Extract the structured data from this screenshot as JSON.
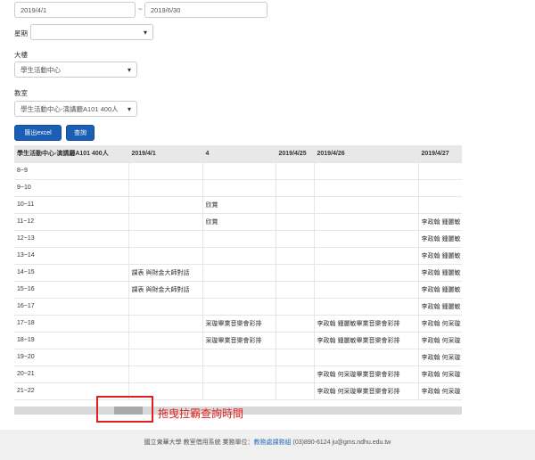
{
  "filters": {
    "date_start": "2019/4/1",
    "date_sep": "~",
    "date_end": "2019/6/30",
    "weekday_label": "星期",
    "weekday_value": "",
    "building_label": "大樓",
    "building_value": "學生活動中心",
    "room_label": "教室",
    "room_value": "學生活動中心-演講廳A101 400人"
  },
  "buttons": {
    "export": "匯出excel",
    "query": "查詢"
  },
  "table": {
    "headers": [
      "學生活動中心-演講廳A101 400人",
      "2019/4/1",
      "4",
      "2019/4/25",
      "2019/4/26",
      "2019/4/27"
    ],
    "rows": [
      [
        "8~9",
        "",
        "",
        "",
        "",
        ""
      ],
      [
        "9~10",
        "",
        "",
        "",
        "",
        ""
      ],
      [
        "10~11",
        "",
        "欣賞",
        "",
        "",
        ""
      ],
      [
        "11~12",
        "",
        "欣賞",
        "",
        "",
        "李政翰 鍾麗敏"
      ],
      [
        "12~13",
        "",
        "",
        "",
        "",
        "李政翰 鍾麗敏"
      ],
      [
        "13~14",
        "",
        "",
        "",
        "",
        "李政翰 鍾麗敏"
      ],
      [
        "14~15",
        "課表 與財金大師對話",
        "",
        "",
        "",
        "李政翰 鍾麗敏"
      ],
      [
        "15~16",
        "課表 與財金大師對話",
        "",
        "",
        "",
        "李政翰 鍾麗敏"
      ],
      [
        "16~17",
        "",
        "",
        "",
        "",
        "李政翰 鍾麗敏"
      ],
      [
        "17~18",
        "",
        "采璇畢業音樂會彩排",
        "",
        "李政翰 鍾麗敏畢業音樂會彩排",
        "李政翰 何采璇"
      ],
      [
        "18~19",
        "",
        "采璇畢業音樂會彩排",
        "",
        "李政翰 鍾麗敏畢業音樂會彩排",
        "李政翰 何采璇"
      ],
      [
        "19~20",
        "",
        "",
        "",
        "",
        "李政翰 何采璇"
      ],
      [
        "20~21",
        "",
        "",
        "",
        "李政翰 何采璇畢業音樂會彩排",
        "李政翰 何采璇"
      ],
      [
        "21~22",
        "",
        "",
        "",
        "李政翰 何采璇畢業音樂會彩排",
        "李政翰 何采璇"
      ]
    ]
  },
  "annotation": "拖曳拉霸查詢時間",
  "footer": {
    "text_before": "國立東華大學 教室借用系統 業務單位：",
    "link": "教務處課務組",
    "text_after": " (03)890-6124 ju@gms.ndhu.edu.tw"
  },
  "colors": {
    "button_blue": "#1a5fb4",
    "annotation_red": "#e02020",
    "header_gray": "#e8e8e8"
  }
}
